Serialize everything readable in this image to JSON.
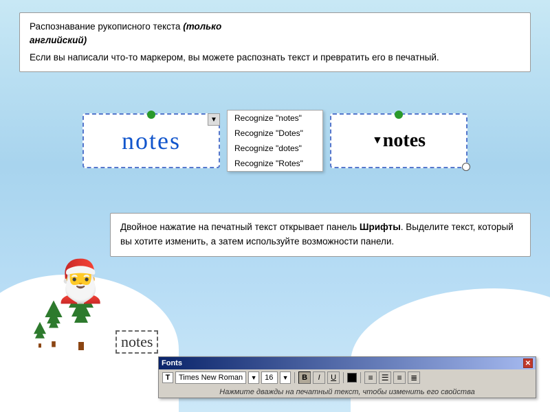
{
  "background": {
    "color": "#b8ddf5"
  },
  "top_info_box": {
    "line1": "Распознавание рукописного текста (только английский)",
    "line2": "Если вы написали что-то маркером, вы можете распознать текст и превратить его в печатный."
  },
  "demo": {
    "handwritten_text": "notes",
    "recognized_text": "notes",
    "context_menu": {
      "items": [
        "Recognize \"notes\"",
        "Recognize \"Dotes\"",
        "Recognize \"dotes\"",
        "Recognize \"Rotes\""
      ]
    }
  },
  "bottom_info_box": {
    "text": "Двойное нажатие на печатный текст открывает панель Шрифты. Выделите текст, который вы хотите изменить, а затем используйте возможности панели."
  },
  "notes_label": "notes",
  "fonts_toolbar": {
    "title": "Fonts",
    "close_label": "✕",
    "font_icon": "T",
    "font_name": "Times New Roman",
    "font_size": "16",
    "bold_label": "B",
    "italic_label": "I",
    "underline_label": "U",
    "dropdown_arrow": "▼",
    "caption": "Нажмите дважды на печатный текст, чтобы изменить его свойства"
  }
}
